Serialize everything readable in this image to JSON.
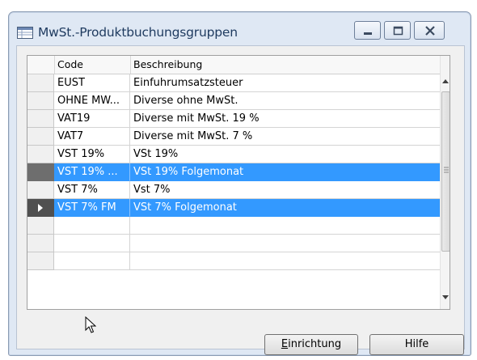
{
  "window": {
    "title": "MwSt.-Produktbuchungsgruppen",
    "icon": "table-window-icon"
  },
  "table": {
    "columns": [
      "Code",
      "Beschreibung"
    ],
    "rows": [
      {
        "code": "EUST",
        "description": "Einfuhrumsatzsteuer",
        "selected": false,
        "current": false
      },
      {
        "code": "OHNE MW...",
        "description": "Diverse ohne MwSt.",
        "selected": false,
        "current": false
      },
      {
        "code": "VAT19",
        "description": "Diverse mit MwSt. 19 %",
        "selected": false,
        "current": false
      },
      {
        "code": "VAT7",
        "description": "Diverse mit MwSt. 7 %",
        "selected": false,
        "current": false
      },
      {
        "code": "VST 19%",
        "description": "VSt 19%",
        "selected": false,
        "current": false
      },
      {
        "code": "VST 19% ...",
        "description": "VSt 19% Folgemonat",
        "selected": true,
        "current": false
      },
      {
        "code": "VST 7%",
        "description": "Vst 7%",
        "selected": false,
        "current": false
      },
      {
        "code": "VST 7% FM",
        "description": "VSt 7% Folgemonat",
        "selected": true,
        "current": true
      },
      {
        "code": "",
        "description": "",
        "selected": false,
        "current": false
      },
      {
        "code": "",
        "description": "",
        "selected": false,
        "current": false
      },
      {
        "code": "",
        "description": "",
        "selected": false,
        "current": false
      }
    ]
  },
  "buttons": {
    "setup": {
      "mnemonic": "E",
      "rest": "inrichtung"
    },
    "help": "Hilfe"
  },
  "colors": {
    "selection": "#3399ff",
    "title_text": "#1e3a5f"
  }
}
